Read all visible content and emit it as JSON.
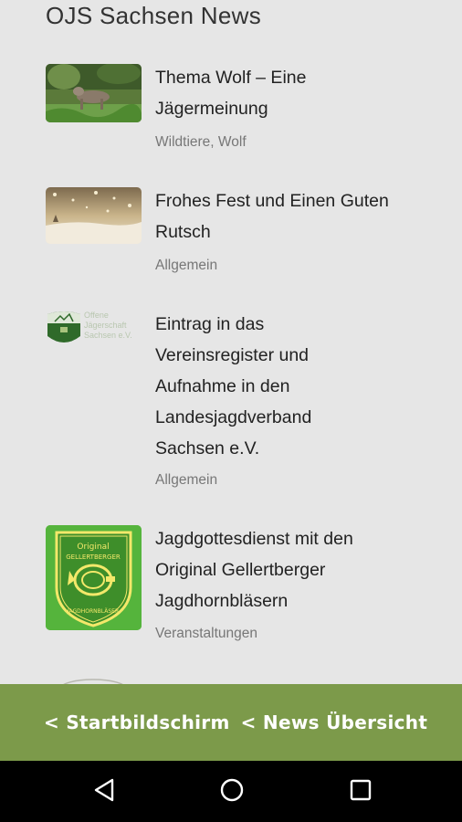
{
  "header": {
    "title": "OJS Sachsen News"
  },
  "news": [
    {
      "title_lines": [
        "Thema Wolf – Eine",
        "Jägermeinung"
      ],
      "category": "Wildtiere, Wolf"
    },
    {
      "title_lines": [
        "Frohes Fest und Einen Guten",
        "Rutsch"
      ],
      "category": "Allgemein"
    },
    {
      "title_lines": [
        "Eintrag in das",
        "Vereinsregister und",
        "Aufnahme in den",
        "Landesjagdverband",
        "Sachsen e.V."
      ],
      "category": "Allgemein"
    },
    {
      "title_lines": [
        "Jagdgottesdienst mit den",
        "Original Gellertberger",
        "Jagdhornbläsern"
      ],
      "category": "Veranstaltungen"
    }
  ],
  "thumb3": {
    "logo_text": [
      "Offene",
      "Jägerschaft",
      "Sachsen e.V."
    ]
  },
  "thumb4": {
    "badge_top": "Original",
    "badge_middle": "GELLERTBERGER",
    "badge_bottom": "JAGDHORNBLÄSER"
  },
  "bottom_nav": {
    "home_label": "< Startbildschirm",
    "overview_label": "< News Übersicht"
  },
  "colors": {
    "bar": "#7c9a4a",
    "badge_green": "#55b43c"
  },
  "system_nav": {
    "back": "back-icon",
    "home": "home-icon",
    "recents": "recents-icon"
  }
}
